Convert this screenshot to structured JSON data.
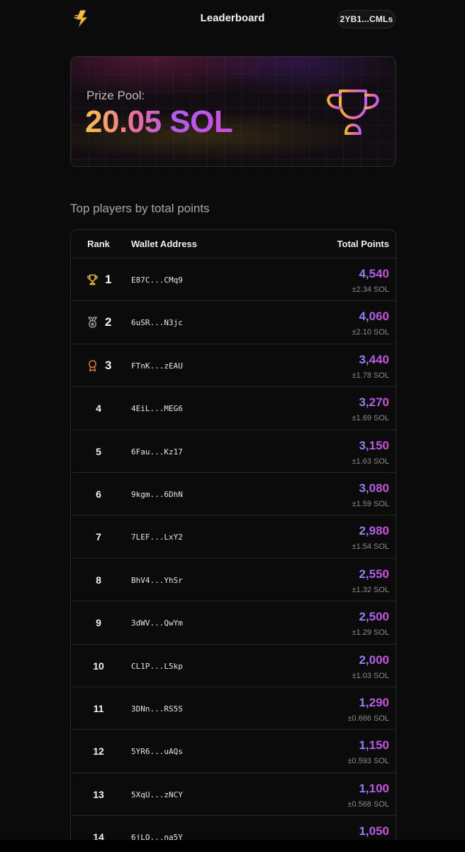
{
  "header": {
    "title": "Leaderboard",
    "wallet_label": "2YB1...CMLs",
    "logo_icon": "lightning-bolt-icon"
  },
  "prize": {
    "label": "Prize Pool:",
    "value": "20.05 SOL",
    "icon": "trophy-icon"
  },
  "section_title": "Top players by total points",
  "table": {
    "columns": [
      "Rank",
      "Wallet Address",
      "Total Points"
    ],
    "rows": [
      {
        "rank": "1",
        "address": "E87C...CMq9",
        "points": "4,540",
        "sol": "±2.34 SOL",
        "medal": "trophy-icon"
      },
      {
        "rank": "2",
        "address": "6uSR...N3jc",
        "points": "4,060",
        "sol": "±2.10 SOL",
        "medal": "silver-medal-icon"
      },
      {
        "rank": "3",
        "address": "FTnK...zEAU",
        "points": "3,440",
        "sol": "±1.78 SOL",
        "medal": "bronze-award-icon"
      },
      {
        "rank": "4",
        "address": "4EiL...MEG6",
        "points": "3,270",
        "sol": "±1.69 SOL"
      },
      {
        "rank": "5",
        "address": "6Fau...Kz17",
        "points": "3,150",
        "sol": "±1.63 SOL"
      },
      {
        "rank": "6",
        "address": "9kgm...6DhN",
        "points": "3,080",
        "sol": "±1.59 SOL"
      },
      {
        "rank": "7",
        "address": "7LEF...LxY2",
        "points": "2,980",
        "sol": "±1.54 SOL"
      },
      {
        "rank": "8",
        "address": "BhV4...YhSr",
        "points": "2,550",
        "sol": "±1.32 SOL"
      },
      {
        "rank": "9",
        "address": "3dWV...QwYm",
        "points": "2,500",
        "sol": "±1.29 SOL"
      },
      {
        "rank": "10",
        "address": "CL1P...L5kp",
        "points": "2,000",
        "sol": "±1.03 SOL"
      },
      {
        "rank": "11",
        "address": "3DNn...RS5S",
        "points": "1,290",
        "sol": "±0.666 SOL"
      },
      {
        "rank": "12",
        "address": "5YR6...uAQs",
        "points": "1,150",
        "sol": "±0.593 SOL"
      },
      {
        "rank": "13",
        "address": "5XqU...zNCY",
        "points": "1,100",
        "sol": "±0.568 SOL"
      },
      {
        "rank": "14",
        "address": "6jLQ...na5Y",
        "points": "1,050",
        "sol": ""
      }
    ]
  },
  "colors": {
    "background": "#0b0b0b",
    "gold": "#f2b632",
    "silver": "#9a9a9a",
    "bronze": "#e0782c",
    "points_gradient_start": "#8f8cf5",
    "points_gradient_end": "#d64fd7"
  }
}
